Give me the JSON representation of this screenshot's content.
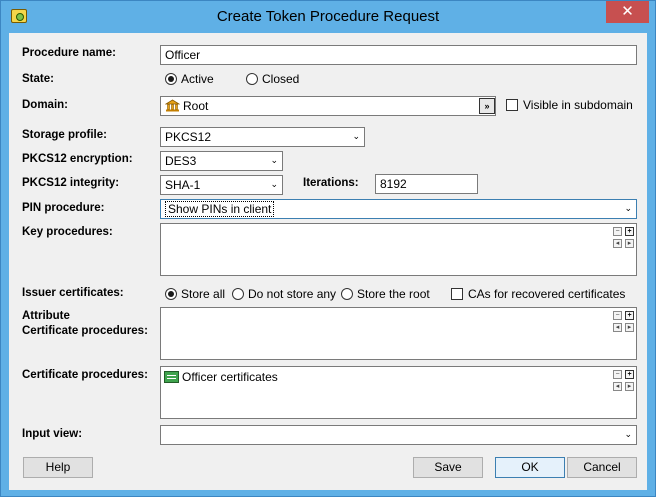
{
  "window": {
    "title": "Create Token Procedure Request",
    "close_glyph": "✕"
  },
  "labels": {
    "procedure_name": "Procedure name:",
    "state": "State:",
    "domain": "Domain:",
    "storage_profile": "Storage profile:",
    "pkcs12_encryption": "PKCS12 encryption:",
    "pkcs12_integrity": "PKCS12 integrity:",
    "iterations": "Iterations:",
    "pin_procedure": "PIN procedure:",
    "key_procedures": "Key procedures:",
    "issuer_certificates": "Issuer certificates:",
    "attribute_cert_line1": "Attribute",
    "attribute_cert_line2": "Certificate procedures:",
    "certificate_procedures": "Certificate procedures:",
    "input_view": "Input view:"
  },
  "fields": {
    "procedure_name": "Officer",
    "domain": "Root",
    "domain_browse": "»",
    "visible_in_subdomain": "Visible in subdomain",
    "storage_profile": "PKCS12",
    "pkcs12_encryption": "DES3",
    "pkcs12_integrity": "SHA-1",
    "iterations": "8192",
    "pin_procedure": "Show PINs in client",
    "input_view": ""
  },
  "state_options": [
    {
      "label": "Active",
      "selected": true
    },
    {
      "label": "Closed",
      "selected": false
    }
  ],
  "issuer_options": [
    {
      "label": "Store all",
      "selected": true
    },
    {
      "label": "Do not store any",
      "selected": false
    },
    {
      "label": "Store the root",
      "selected": false
    }
  ],
  "cas_recovered": "CAs for recovered certificates",
  "certificate_procedures_items": [
    "Officer certificates"
  ],
  "mini_buttons": {
    "minus": "−",
    "plus": "+",
    "left": "◂",
    "right": "▸"
  },
  "arrow_glyph": "⌄",
  "buttons": {
    "help": "Help",
    "save": "Save",
    "ok": "OK",
    "cancel": "Cancel"
  },
  "icons": {
    "app": "token-app-icon",
    "domain": "bank-building-icon",
    "certificate": "certificate-icon"
  },
  "colors": {
    "title_bar": "#5fb0e6",
    "close_button": "#c75050",
    "dialog_background": "#f0f0f0",
    "default_button_border": "#3c7fb1"
  }
}
